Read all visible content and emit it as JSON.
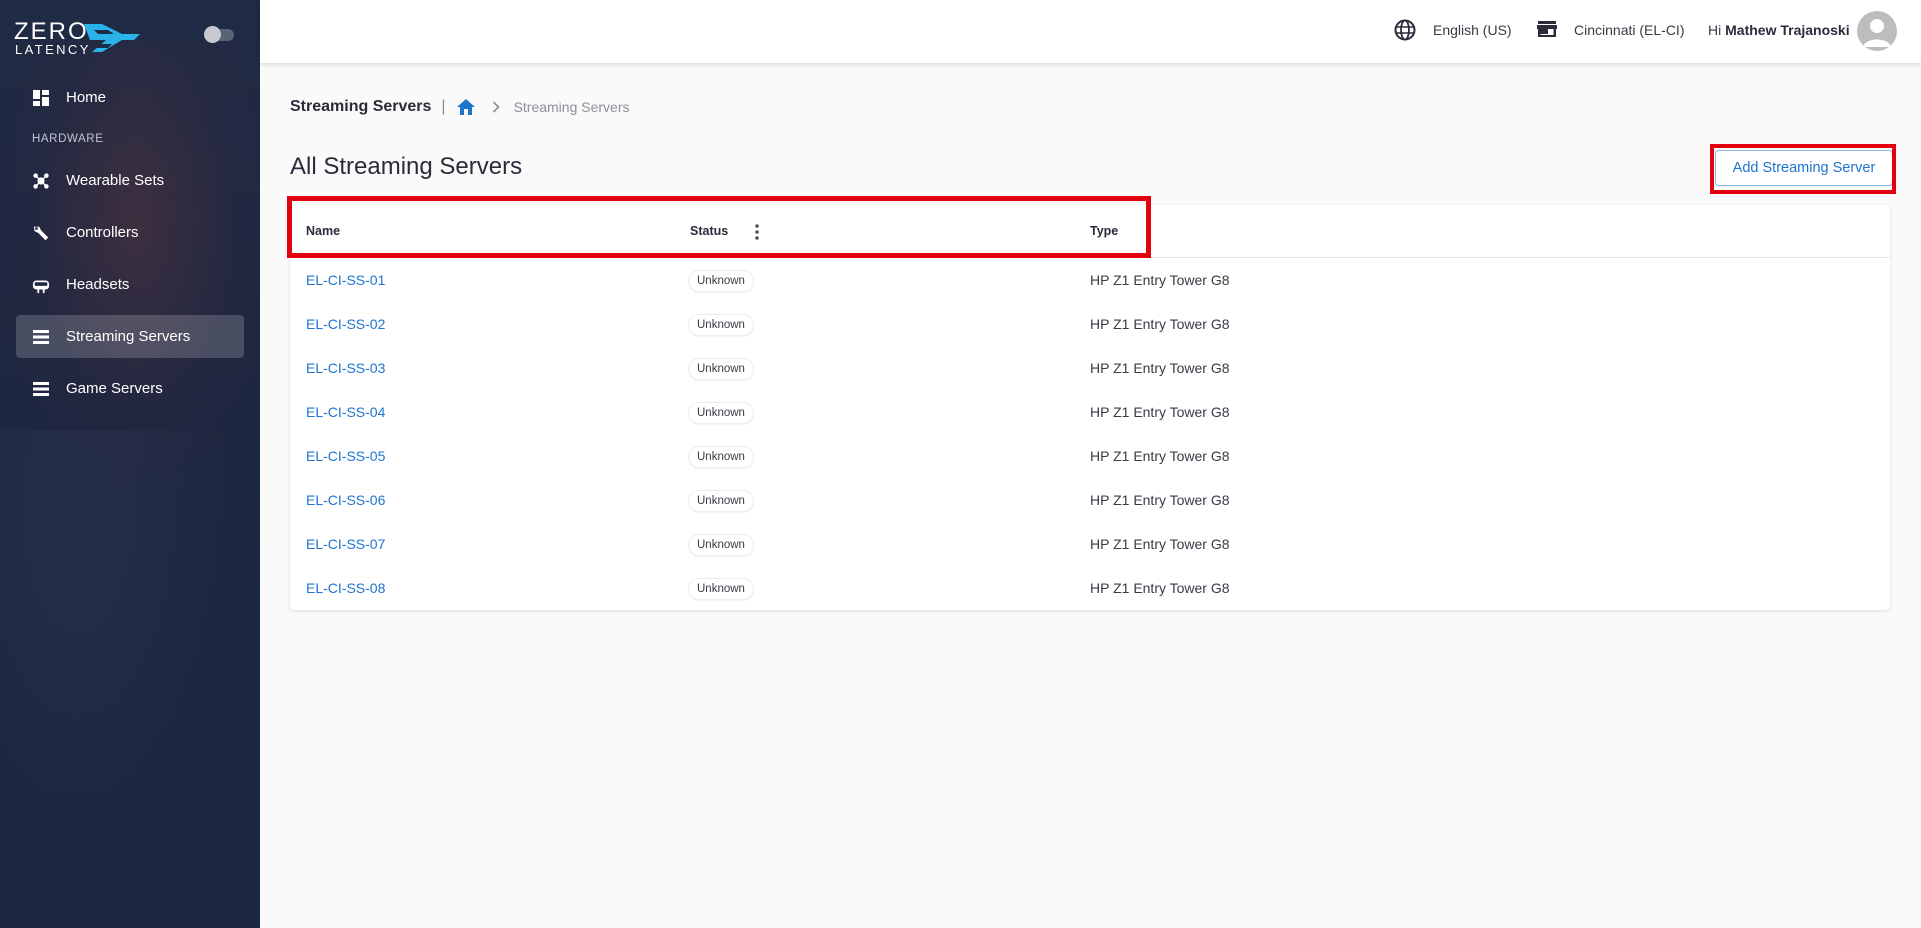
{
  "brand": {
    "logo_line1": "ZERO",
    "logo_line2": "LATENCY",
    "accent": "#1e74cf",
    "sidebar_bg": "#1f2a44",
    "highlight": "#e3000f"
  },
  "sidebar": {
    "section_hardware": "HARDWARE",
    "items": [
      {
        "label": "Home",
        "icon": "dashboard-icon"
      },
      {
        "label": "Wearable Sets",
        "icon": "wearable-icon"
      },
      {
        "label": "Controllers",
        "icon": "controller-icon"
      },
      {
        "label": "Headsets",
        "icon": "headset-icon"
      },
      {
        "label": "Streaming Servers",
        "icon": "server-icon",
        "active": true
      },
      {
        "label": "Game Servers",
        "icon": "server-icon"
      }
    ]
  },
  "topbar": {
    "language": "English (US)",
    "location": "Cincinnati (EL-CI)",
    "greeting": "Hi",
    "user": "Mathew Trajanoski"
  },
  "breadcrumb": {
    "title": "Streaming Servers",
    "separator": "|",
    "current": "Streaming Servers"
  },
  "page": {
    "title": "All Streaming Servers",
    "add_button": "Add Streaming Server"
  },
  "table": {
    "columns": [
      "Name",
      "Status",
      "Type"
    ],
    "rows": [
      {
        "name": "EL-CI-SS-01",
        "status": "Unknown",
        "type": "HP Z1 Entry Tower G8"
      },
      {
        "name": "EL-CI-SS-02",
        "status": "Unknown",
        "type": "HP Z1 Entry Tower G8"
      },
      {
        "name": "EL-CI-SS-03",
        "status": "Unknown",
        "type": "HP Z1 Entry Tower G8"
      },
      {
        "name": "EL-CI-SS-04",
        "status": "Unknown",
        "type": "HP Z1 Entry Tower G8"
      },
      {
        "name": "EL-CI-SS-05",
        "status": "Unknown",
        "type": "HP Z1 Entry Tower G8"
      },
      {
        "name": "EL-CI-SS-06",
        "status": "Unknown",
        "type": "HP Z1 Entry Tower G8"
      },
      {
        "name": "EL-CI-SS-07",
        "status": "Unknown",
        "type": "HP Z1 Entry Tower G8"
      },
      {
        "name": "EL-CI-SS-08",
        "status": "Unknown",
        "type": "HP Z1 Entry Tower G8"
      }
    ]
  }
}
